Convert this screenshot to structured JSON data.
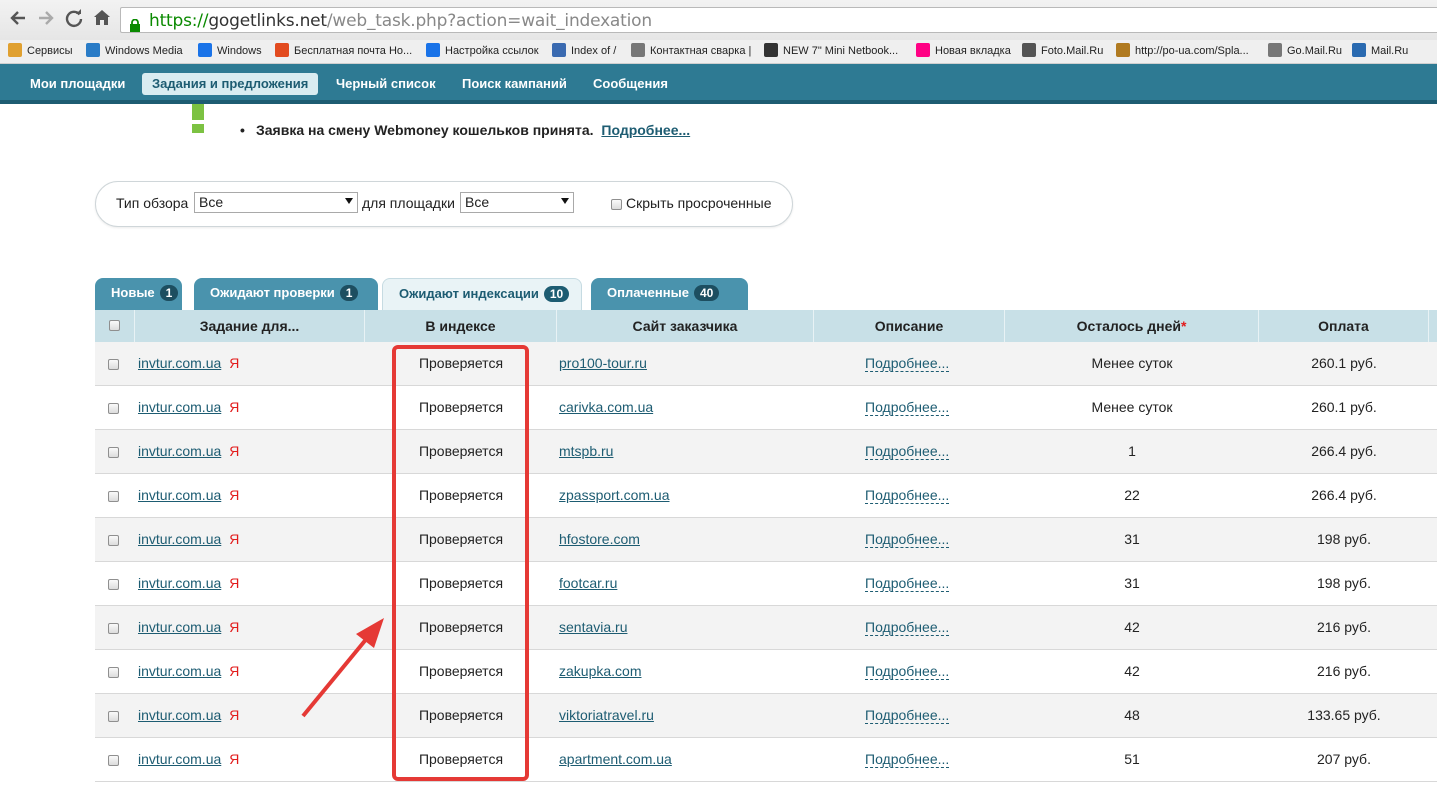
{
  "browser": {
    "url_https": "https://",
    "url_host": "gogetlinks.net",
    "url_rest": "/web_task.php?action=wait_indexation",
    "back_icon": "arrow-left-icon",
    "forward_icon": "arrow-right-icon",
    "reload_icon": "reload-icon",
    "home_icon": "home-icon"
  },
  "bookmarks": [
    {
      "label": "Сервисы",
      "icon": "apps-grid-icon"
    },
    {
      "label": "Windows Media",
      "icon": "windows-flag-icon"
    },
    {
      "label": "Windows",
      "icon": "windows-logo-icon"
    },
    {
      "label": "Бесплатная почта Но...",
      "icon": "windows-logo-icon"
    },
    {
      "label": "Настройка ссылок",
      "icon": "windows-logo-icon"
    },
    {
      "label": "Index of /",
      "icon": "page-icon"
    },
    {
      "label": "Контактная сварка |",
      "icon": "image-icon"
    },
    {
      "label": "NEW 7\" Mini Netbook...",
      "icon": "tv-icon"
    },
    {
      "label": "Новая вкладка",
      "icon": "flickr-icon"
    },
    {
      "label": "Foto.Mail.Ru",
      "icon": "camera-icon"
    },
    {
      "label": "http://po-ua.com/Spla...",
      "icon": "site-icon"
    },
    {
      "label": "Go.Mail.Ru",
      "icon": "page-icon"
    },
    {
      "label": "Mail.Ru",
      "icon": "mailru-icon"
    }
  ],
  "site_nav": [
    {
      "label": "Мои площадки",
      "active": false
    },
    {
      "label": "Задания и предложения",
      "active": true
    },
    {
      "label": "Черный список",
      "active": false
    },
    {
      "label": "Поиск кампаний",
      "active": false
    },
    {
      "label": "Сообщения",
      "active": false
    }
  ],
  "notice": {
    "text": "Заявка на смену Webmoney кошельков принята.",
    "link": "Подробнее..."
  },
  "filter": {
    "view_type_label": "Тип обзора",
    "view_type_value": "Все",
    "platform_label": "для площадки",
    "platform_value": "Все",
    "hide_expired_label": "Скрыть просроченные"
  },
  "tabs": [
    {
      "label": "Новые",
      "count": "1",
      "active": false
    },
    {
      "label": "Ожидают проверки",
      "count": "1",
      "active": false
    },
    {
      "label": "Ожидают индексации",
      "count": "10",
      "active": true
    },
    {
      "label": "Оплаченные",
      "count": "40",
      "active": false
    }
  ],
  "table": {
    "headers": [
      "Задание для...",
      "В индексе",
      "Сайт заказчика",
      "Описание",
      "Осталось дней",
      "Оплата"
    ],
    "required_mark": "*",
    "yandex_mark": "Я",
    "rows": [
      {
        "task": "invtur.com.ua",
        "status": "Проверяется",
        "site": "pro100-tour.ru",
        "desc": "Подробнее...",
        "days": "Менее суток",
        "pay": "260.1 руб."
      },
      {
        "task": "invtur.com.ua",
        "status": "Проверяется",
        "site": "carivka.com.ua",
        "desc": "Подробнее...",
        "days": "Менее суток",
        "pay": "260.1 руб."
      },
      {
        "task": "invtur.com.ua",
        "status": "Проверяется",
        "site": "mtspb.ru",
        "desc": "Подробнее...",
        "days": "1",
        "pay": "266.4 руб."
      },
      {
        "task": "invtur.com.ua",
        "status": "Проверяется",
        "site": "zpassport.com.ua",
        "desc": "Подробнее...",
        "days": "22",
        "pay": "266.4 руб."
      },
      {
        "task": "invtur.com.ua",
        "status": "Проверяется",
        "site": "hfostore.com",
        "desc": "Подробнее...",
        "days": "31",
        "pay": "198 руб."
      },
      {
        "task": "invtur.com.ua",
        "status": "Проверяется",
        "site": "footcar.ru",
        "desc": "Подробнее...",
        "days": "31",
        "pay": "198 руб."
      },
      {
        "task": "invtur.com.ua",
        "status": "Проверяется",
        "site": "sentavia.ru",
        "desc": "Подробнее...",
        "days": "42",
        "pay": "216 руб."
      },
      {
        "task": "invtur.com.ua",
        "status": "Проверяется",
        "site": "zakupka.com",
        "desc": "Подробнее...",
        "days": "42",
        "pay": "216 руб."
      },
      {
        "task": "invtur.com.ua",
        "status": "Проверяется",
        "site": "viktoriatravel.ru",
        "desc": "Подробнее...",
        "days": "48",
        "pay": "133.65 руб."
      },
      {
        "task": "invtur.com.ua",
        "status": "Проверяется",
        "site": "apartment.com.ua",
        "desc": "Подробнее...",
        "days": "51",
        "pay": "207 руб."
      }
    ]
  },
  "colors": {
    "site_nav_bg": "#2e7a93",
    "accent_dark": "#1d5c72",
    "annotation_red": "#e53935",
    "url_green": "#0a8a00"
  }
}
